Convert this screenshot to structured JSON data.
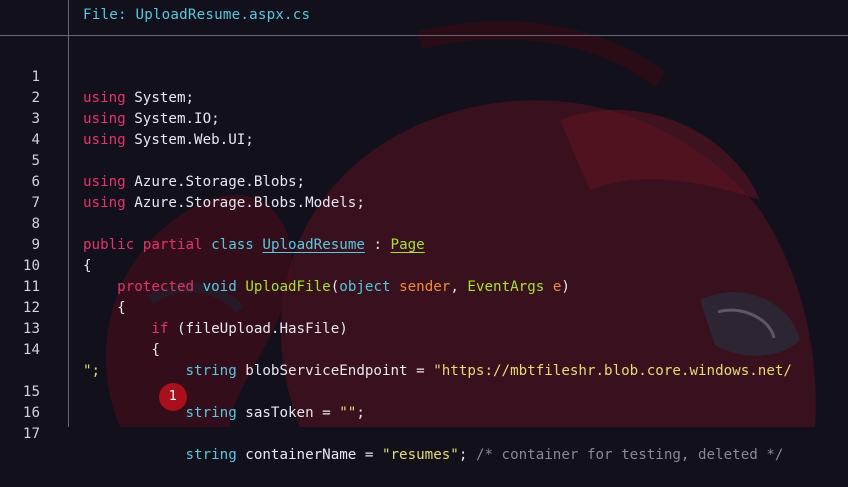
{
  "header": {
    "file_label": "File: UploadResume.aspx.cs"
  },
  "annotation": {
    "badge_number": "1"
  },
  "colors": {
    "keyword": "#e6336e",
    "type": "#58c7e0",
    "function": "#a6e22e",
    "string": "#e6db74",
    "parameter": "#f08a3c",
    "comment": "#8b8798",
    "badge": "#a8101e"
  },
  "code": {
    "line_numbers": [
      "1",
      "2",
      "3",
      "4",
      "5",
      "6",
      "7",
      "8",
      "9",
      "10",
      "11",
      "12",
      "13",
      "14",
      "15",
      "16",
      "17"
    ],
    "l1": {
      "kw": "using",
      "ns": " System;"
    },
    "l2": {
      "kw": "using",
      "ns": " System.IO;"
    },
    "l3": {
      "kw": "using",
      "ns": " System.Web.UI;"
    },
    "l5": {
      "kw": "using",
      "ns": " Azure.Storage.Blobs;"
    },
    "l6": {
      "kw": "using",
      "ns": " Azure.Storage.Blobs.Models;"
    },
    "l8": {
      "kw1": "public",
      "kw2": "partial",
      "kw3": "class",
      "class_name": "UploadResume",
      "colon": " : ",
      "base": "Page"
    },
    "l9": {
      "brace": "{"
    },
    "l10": {
      "kw1": "protected",
      "kw2": "void",
      "method": "UploadFile",
      "open": "(",
      "t1": "object",
      "p1": "sender",
      "comma": ", ",
      "t2": "EventArgs",
      "p2": "e",
      "close": ")"
    },
    "l11": {
      "brace": "{"
    },
    "l12": {
      "kw": "if",
      "rest": " (fileUpload.HasFile)"
    },
    "l13": {
      "brace": "{"
    },
    "l14": {
      "type": "string",
      "name": " blobServiceEndpoint",
      "eq": " = ",
      "value": "\"https://mbtfileshr.blob.core.windows.net/",
      "wrap": "\";"
    },
    "l15": {
      "type": "string",
      "name": " sasToken",
      "eq": " = ",
      "value": "\"\"",
      "end": ";"
    },
    "l16": {
      "type": "string",
      "name": " containerName",
      "eq": " = ",
      "value": "\"resumes\"",
      "end": "; ",
      "comment": "/* container for testing, deleted */"
    }
  }
}
